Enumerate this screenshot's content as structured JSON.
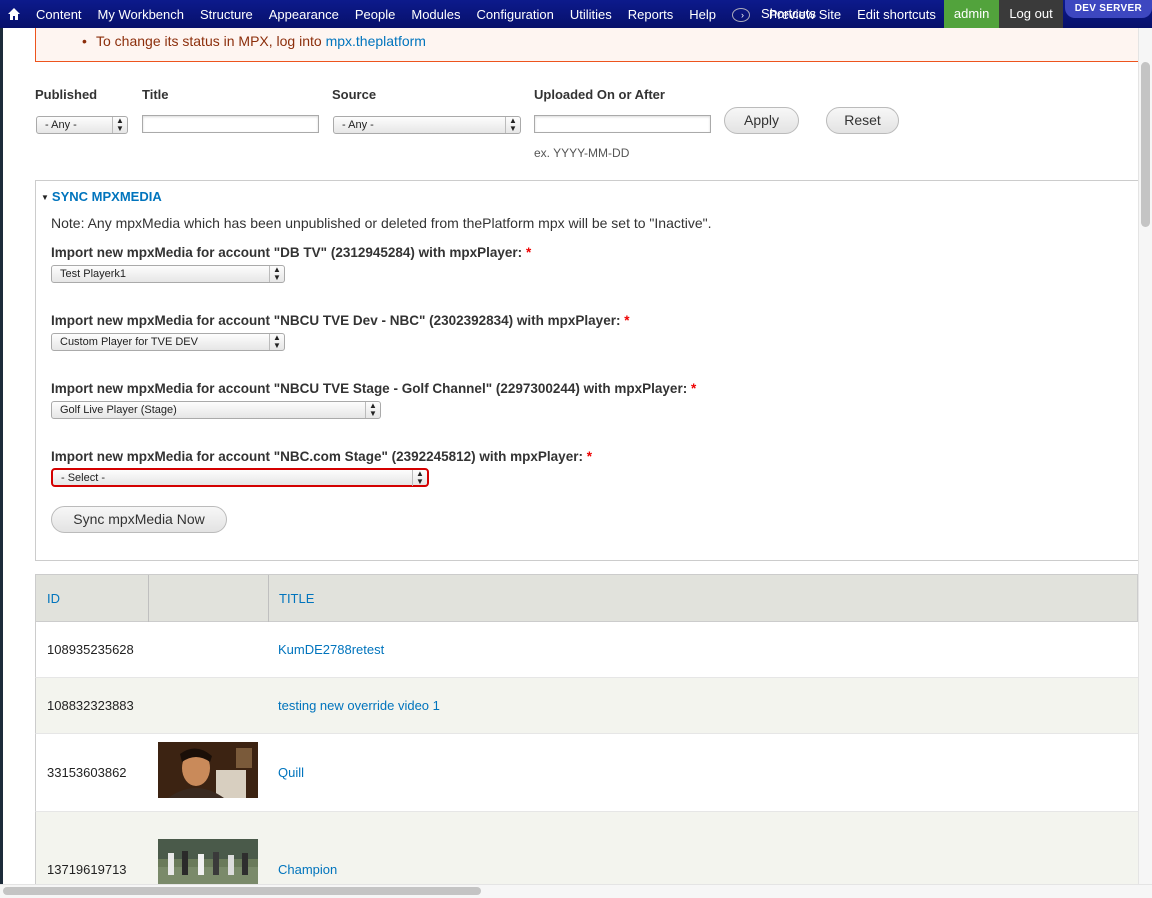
{
  "toolbar": {
    "menu": [
      "Content",
      "My Workbench",
      "Structure",
      "Appearance",
      "People",
      "Modules",
      "Configuration",
      "Utilities",
      "Reports",
      "Help"
    ],
    "shortcuts_label": "Shortcuts",
    "preview_site": "Preview Site",
    "edit_shortcuts": "Edit shortcuts",
    "admin": "admin",
    "logout": "Log out",
    "dev_server": "DEV SERVER"
  },
  "message": {
    "text": "To change its status in MPX, log into ",
    "link": "mpx.theplatform"
  },
  "filters": {
    "published_label": "Published",
    "published_value": "- Any -",
    "title_label": "Title",
    "title_value": "",
    "source_label": "Source",
    "source_value": "- Any -",
    "uploaded_label": "Uploaded On or After",
    "uploaded_value": "",
    "uploaded_hint": "ex. YYYY-MM-DD",
    "apply": "Apply",
    "reset": "Reset"
  },
  "sync": {
    "legend": "SYNC MPXMEDIA",
    "note": "Note: Any mpxMedia which has been unpublished or deleted from thePlatform mpx will be set to \"Inactive\".",
    "accounts": [
      {
        "label": "Import new mpxMedia for account \"DB TV\" (2312945284) with mpxPlayer:",
        "required": "*",
        "value": "Test Playerk1"
      },
      {
        "label": "Import new mpxMedia for account \"NBCU TVE Dev - NBC\" (2302392834) with mpxPlayer:",
        "required": "*",
        "value": "Custom Player for TVE DEV"
      },
      {
        "label": "Import new mpxMedia for account \"NBCU TVE Stage - Golf Channel\" (2297300244) with mpxPlayer:",
        "required": "*",
        "value": "Golf Live Player (Stage)"
      },
      {
        "label": "Import new mpxMedia for account \"NBC.com Stage\" (2392245812) with mpxPlayer:",
        "required": "*",
        "value": "- Select -"
      }
    ],
    "button": "Sync mpxMedia Now"
  },
  "table": {
    "headers": [
      "ID",
      "",
      "TITLE"
    ],
    "rows": [
      {
        "id": "108935235628",
        "title": "KumDE2788retest",
        "thumb": ""
      },
      {
        "id": "108832323883",
        "title": "testing new override video 1",
        "thumb": ""
      },
      {
        "id": "33153603862",
        "title": "Quill",
        "thumb": "portrait-thumbnail"
      },
      {
        "id": "13719619713",
        "title": "Champion",
        "thumb": "golf-thumbnail"
      }
    ]
  },
  "colors": {
    "toolbar": "#0c1a8c",
    "link": "#0074bd",
    "admin": "#52a33c",
    "error_border": "#d40000"
  }
}
